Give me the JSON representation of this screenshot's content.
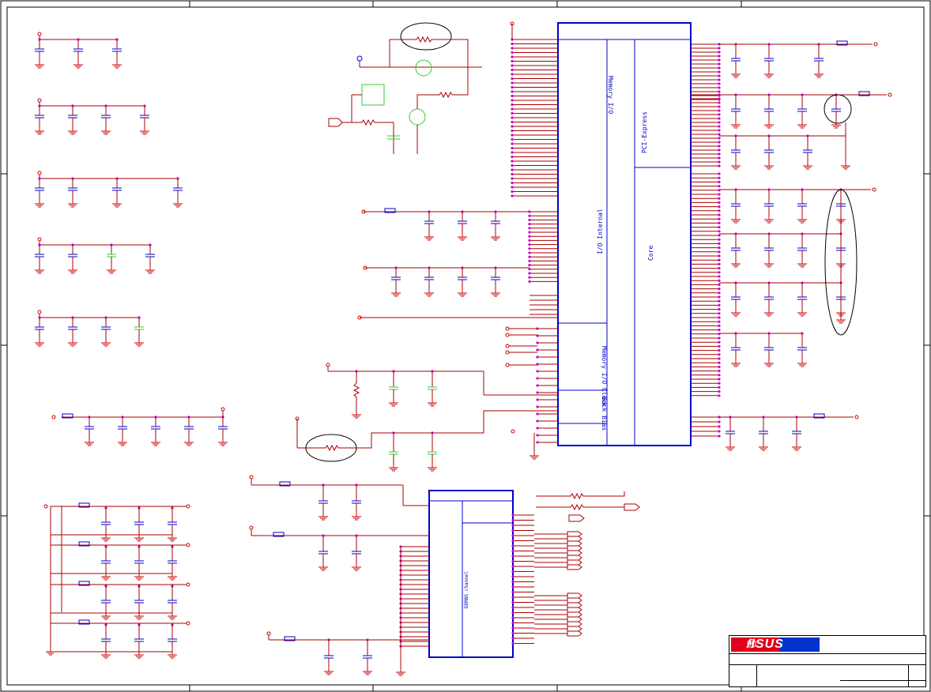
{
  "logo": {
    "text": "/ISUS",
    "registered": "®"
  },
  "blocks": {
    "main_ic": {
      "memory_io": "Memory I/O",
      "pci_express": "PCI-Express",
      "io_internal": "I/O Internal",
      "core": "Core",
      "memory_io_clock": "Memory I/O Clock",
      "back_bias": "Back Bias"
    },
    "lower_ic": {
      "label": "DDRNS channel"
    }
  },
  "colors": {
    "wire": "#aa0000",
    "pin": "#cc00cc",
    "ic_outline": "#0000cc",
    "cap": "#0000cc",
    "alt_part": "#33cc33",
    "ground": "#cc0000"
  }
}
